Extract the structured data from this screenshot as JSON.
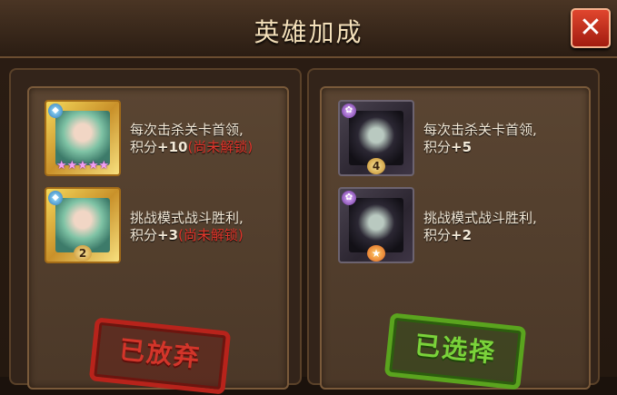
{
  "title": "英雄加成",
  "close_icon": "close-icon",
  "left_panel": {
    "rows": [
      {
        "card_style": "gold",
        "rank_display": "★★★★★",
        "line1": "每次击杀关卡首领,",
        "line2_prefix": "积分",
        "line2_value": "+10",
        "line2_status": "(尚未解锁)"
      },
      {
        "card_style": "gold",
        "rank_display": "2",
        "line1": "挑战模式战斗胜利,",
        "line2_prefix": "积分",
        "line2_value": "+3",
        "line2_status": "(尚未解锁)"
      }
    ],
    "stamp_text": "已放弃",
    "stamp_color": "#d3352a"
  },
  "right_panel": {
    "rows": [
      {
        "card_style": "dark",
        "rank_display": "4",
        "line1": "每次击杀关卡首领,",
        "line2_prefix": "积分",
        "line2_value": "+5"
      },
      {
        "card_style": "dark",
        "rank_display": "★",
        "line1": "挑战模式战斗胜利,",
        "line2_prefix": "积分",
        "line2_value": "+2"
      }
    ],
    "stamp_text": "已选择",
    "stamp_color": "#7ad23a"
  },
  "colors": {
    "locked_text": "#e0342a",
    "body_text": "#f4ead8",
    "title_text": "#f3dfb9",
    "close_button": "#c8301e"
  }
}
